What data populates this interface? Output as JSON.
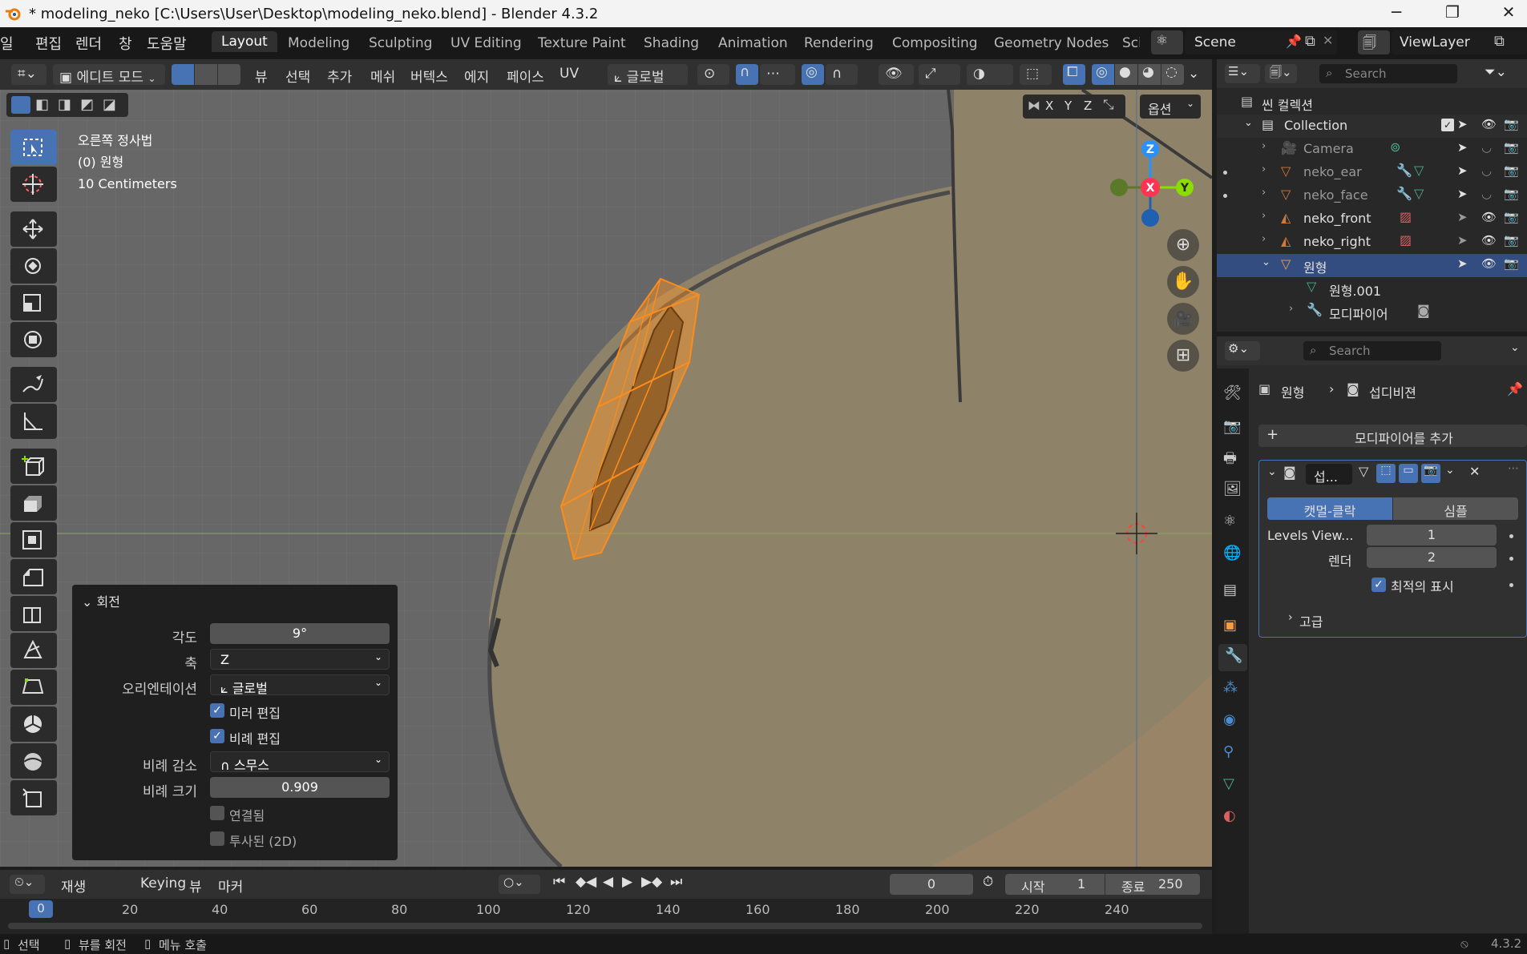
{
  "window": {
    "title": "* modeling_neko [C:\\Users\\User\\Desktop\\modeling_neko.blend] - Blender 4.3.2"
  },
  "menu": [
    "일",
    "편집",
    "렌더",
    "창",
    "도움말"
  ],
  "workspaces": [
    "Layout",
    "Modeling",
    "Sculpting",
    "UV Editing",
    "Texture Paint",
    "Shading",
    "Animation",
    "Rendering",
    "Compositing",
    "Geometry Nodes",
    "Sci"
  ],
  "scene": {
    "name": "Scene",
    "view_layer": "ViewLayer"
  },
  "header": {
    "mode": "에디트 모드",
    "menus": [
      "뷰",
      "선택",
      "추가",
      "메쉬",
      "버텍스",
      "에지",
      "페이스",
      "UV"
    ],
    "transform_orientation": "글로벌",
    "axis_x": "X",
    "axis_y": "Y",
    "axis_z": "Z",
    "options": "옵션"
  },
  "viewport_info": {
    "line1": "오른쪽 정사법",
    "line2": "(0) 원형",
    "line3": "10 Centimeters"
  },
  "gizmo": {
    "z": "Z",
    "x": "X",
    "y": "Y"
  },
  "operator": {
    "title": "회전",
    "angle_label": "각도",
    "angle": "9°",
    "axis_label": "축",
    "axis": "Z",
    "orient_label": "오리엔테이션",
    "orient": "글로벌",
    "mirror": "미러 편집",
    "proportional": "비례 편집",
    "falloff_label": "비례 감소",
    "falloff": "스무스",
    "size_label": "비례 크기",
    "size": "0.909",
    "connected": "연결됨",
    "projected": "투사된 (2D)"
  },
  "outliner": {
    "search_placeholder": "Search",
    "scene_collection": "씬 컬렉션",
    "collection": "Collection",
    "items": [
      "Camera",
      "neko_ear",
      "neko_face",
      "neko_front",
      "neko_right",
      "원형",
      "원형.001",
      "모디파이어"
    ]
  },
  "properties": {
    "search_placeholder": "Search",
    "breadcrumb_object": "원형",
    "breadcrumb_modifier": "섭디비젼",
    "add_modifier": "모디파이어를 추가",
    "modifier_name": "섭...",
    "tab_catmull": "캣멀-클락",
    "tab_simple": "심플",
    "levels_viewport_label": "Levels View...",
    "levels_viewport": "1",
    "render_label": "렌더",
    "render": "2",
    "optimal_display": "최적의 표시",
    "advanced": "고급"
  },
  "timeline": {
    "playback": "재생",
    "keying": "Keying",
    "view": "뷰",
    "marker": "마커",
    "current_frame": "0",
    "start_label": "시작",
    "start": "1",
    "end_label": "종료",
    "end": "250",
    "ticks": [
      "0",
      "20",
      "40",
      "60",
      "80",
      "100",
      "120",
      "140",
      "160",
      "180",
      "200",
      "220",
      "240"
    ]
  },
  "status": {
    "select": "선택",
    "rotate_view": "뷰를 회전",
    "call_menu": "메뉴 호출",
    "version": "4.3.2"
  },
  "colors": {
    "accent": "#4772b3",
    "selection": "#ff8c1a",
    "x_axis": "#ff3352",
    "y_axis": "#8bdc00",
    "z_axis": "#2890ff"
  }
}
